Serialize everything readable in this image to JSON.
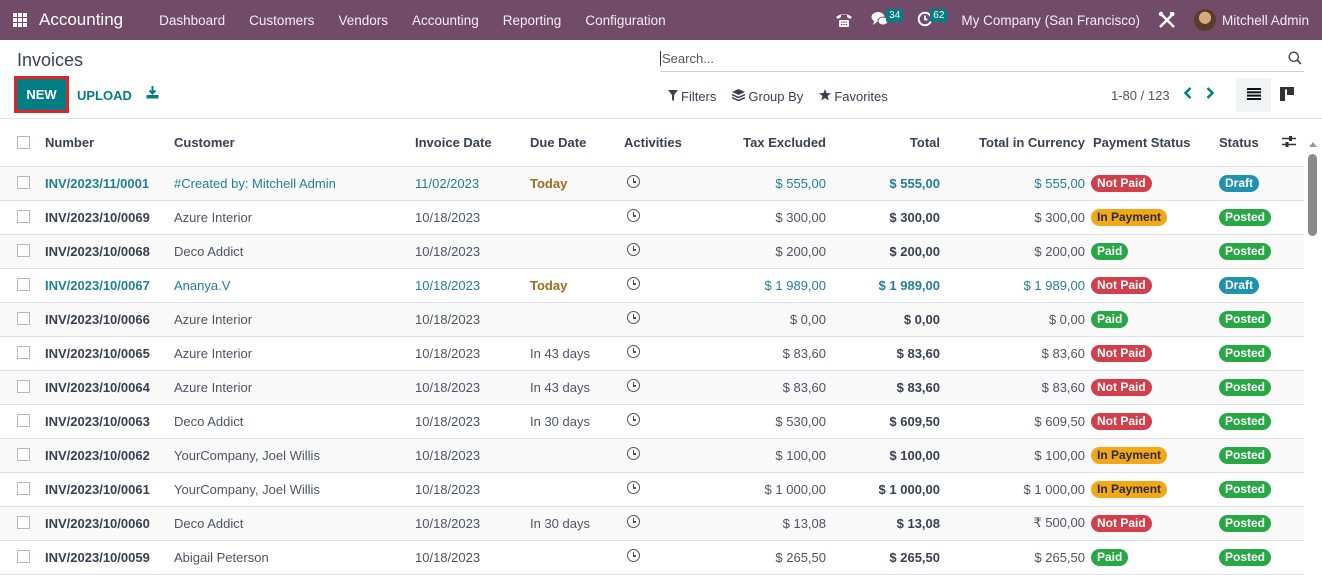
{
  "navbar": {
    "app_name": "Accounting",
    "menu": [
      "Dashboard",
      "Customers",
      "Vendors",
      "Accounting",
      "Reporting",
      "Configuration"
    ],
    "messages_count": "34",
    "activities_count": "62",
    "company": "My Company (San Francisco)",
    "user": "Mitchell Admin"
  },
  "control_panel": {
    "title": "Invoices",
    "new_label": "NEW",
    "upload_label": "UPLOAD",
    "search_placeholder": "Search...",
    "filters_label": "Filters",
    "groupby_label": "Group By",
    "favorites_label": "Favorites",
    "pager": "1-80 / 123"
  },
  "colors": {
    "brand": "#714B67",
    "primary": "#017e84",
    "not_paid": "#d23f4b",
    "in_payment": "#f3a81a",
    "paid": "#28a745",
    "draft": "#2092b1"
  },
  "table": {
    "columns": [
      "Number",
      "Customer",
      "Invoice Date",
      "Due Date",
      "Activities",
      "Tax Excluded",
      "Total",
      "Total in Currency",
      "Payment Status",
      "Status"
    ],
    "rows": [
      {
        "number": "INV/2023/11/0001",
        "customer": "#Created by: Mitchell Admin",
        "invoice_date": "11/02/2023",
        "due_date": "Today",
        "tax_excluded": "$ 555,00",
        "total": "$ 555,00",
        "total_currency": "$ 555,00",
        "payment_status": "Not Paid",
        "status": "Draft"
      },
      {
        "number": "INV/2023/10/0069",
        "customer": "Azure Interior",
        "invoice_date": "10/18/2023",
        "due_date": "",
        "tax_excluded": "$ 300,00",
        "total": "$ 300,00",
        "total_currency": "$ 300,00",
        "payment_status": "In Payment",
        "status": "Posted"
      },
      {
        "number": "INV/2023/10/0068",
        "customer": "Deco Addict",
        "invoice_date": "10/18/2023",
        "due_date": "",
        "tax_excluded": "$ 200,00",
        "total": "$ 200,00",
        "total_currency": "$ 200,00",
        "payment_status": "Paid",
        "status": "Posted"
      },
      {
        "number": "INV/2023/10/0067",
        "customer": "Ananya.V",
        "invoice_date": "10/18/2023",
        "due_date": "Today",
        "tax_excluded": "$ 1 989,00",
        "total": "$ 1 989,00",
        "total_currency": "$ 1 989,00",
        "payment_status": "Not Paid",
        "status": "Draft"
      },
      {
        "number": "INV/2023/10/0066",
        "customer": "Azure Interior",
        "invoice_date": "10/18/2023",
        "due_date": "",
        "tax_excluded": "$ 0,00",
        "total": "$ 0,00",
        "total_currency": "$ 0,00",
        "payment_status": "Paid",
        "status": "Posted"
      },
      {
        "number": "INV/2023/10/0065",
        "customer": "Azure Interior",
        "invoice_date": "10/18/2023",
        "due_date": "In 43 days",
        "tax_excluded": "$ 83,60",
        "total": "$ 83,60",
        "total_currency": "$ 83,60",
        "payment_status": "Not Paid",
        "status": "Posted"
      },
      {
        "number": "INV/2023/10/0064",
        "customer": "Azure Interior",
        "invoice_date": "10/18/2023",
        "due_date": "In 43 days",
        "tax_excluded": "$ 83,60",
        "total": "$ 83,60",
        "total_currency": "$ 83,60",
        "payment_status": "Not Paid",
        "status": "Posted"
      },
      {
        "number": "INV/2023/10/0063",
        "customer": "Deco Addict",
        "invoice_date": "10/18/2023",
        "due_date": "In 30 days",
        "tax_excluded": "$ 530,00",
        "total": "$ 609,50",
        "total_currency": "$ 609,50",
        "payment_status": "Not Paid",
        "status": "Posted"
      },
      {
        "number": "INV/2023/10/0062",
        "customer": "YourCompany, Joel Willis",
        "invoice_date": "10/18/2023",
        "due_date": "",
        "tax_excluded": "$ 100,00",
        "total": "$ 100,00",
        "total_currency": "$ 100,00",
        "payment_status": "In Payment",
        "status": "Posted"
      },
      {
        "number": "INV/2023/10/0061",
        "customer": "YourCompany, Joel Willis",
        "invoice_date": "10/18/2023",
        "due_date": "",
        "tax_excluded": "$ 1 000,00",
        "total": "$ 1 000,00",
        "total_currency": "$ 1 000,00",
        "payment_status": "In Payment",
        "status": "Posted"
      },
      {
        "number": "INV/2023/10/0060",
        "customer": "Deco Addict",
        "invoice_date": "10/18/2023",
        "due_date": "In 30 days",
        "tax_excluded": "$ 13,08",
        "total": "$ 13,08",
        "total_currency": "₹ 500,00",
        "payment_status": "Not Paid",
        "status": "Posted"
      },
      {
        "number": "INV/2023/10/0059",
        "customer": "Abigail Peterson",
        "invoice_date": "10/18/2023",
        "due_date": "",
        "tax_excluded": "$ 265,50",
        "total": "$ 265,50",
        "total_currency": "$ 265,50",
        "payment_status": "Paid",
        "status": "Posted"
      }
    ]
  }
}
